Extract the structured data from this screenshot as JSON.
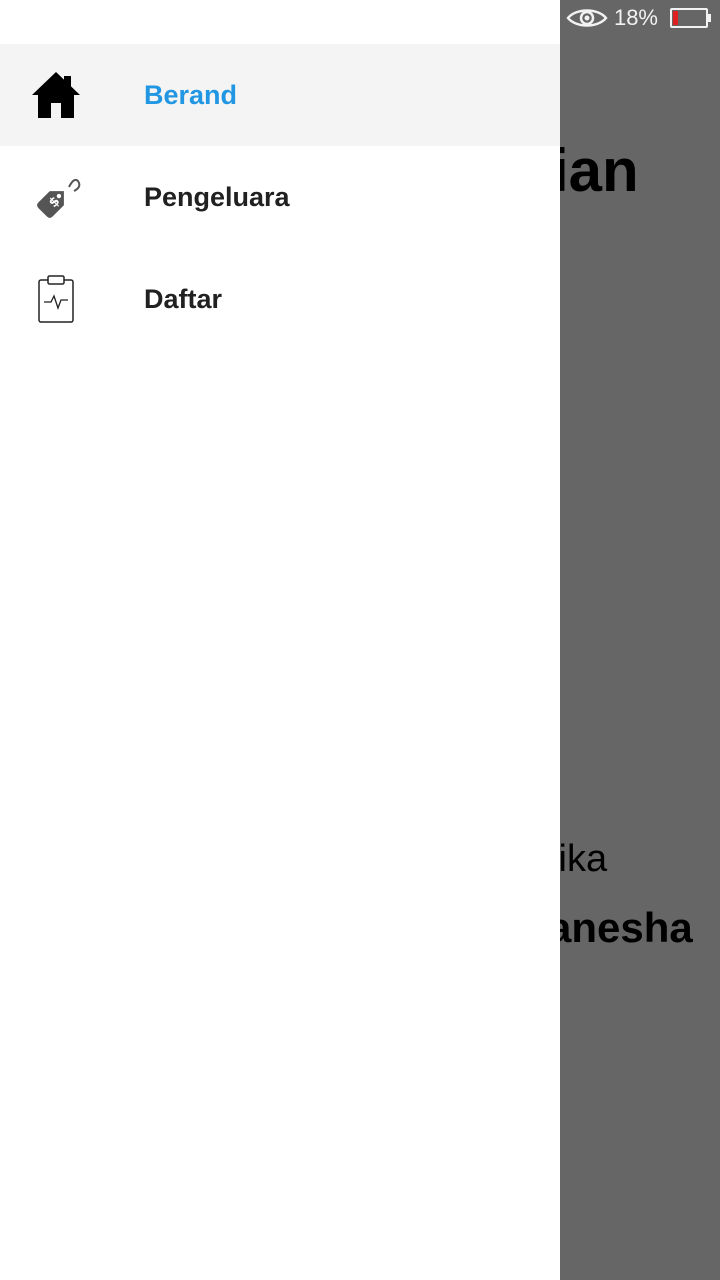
{
  "status_bar": {
    "battery_percent": "18%",
    "battery_level": 0.18,
    "icons": [
      "eye-icon",
      "battery-icon"
    ]
  },
  "background": {
    "title_fragment": "ian",
    "line1_fragment": "tika",
    "line2_fragment": "anesha"
  },
  "drawer": {
    "items": [
      {
        "label": "Berand",
        "icon": "home-icon",
        "active": true
      },
      {
        "label": "Pengeluara",
        "icon": "price-tag-icon",
        "active": false
      },
      {
        "label": "Daftar",
        "icon": "clipboard-icon",
        "active": false
      }
    ]
  },
  "colors": {
    "accent": "#2196e3",
    "scrim": "#666666",
    "active_item_bg": "#f4f4f4",
    "battery_low": "#e02020"
  }
}
